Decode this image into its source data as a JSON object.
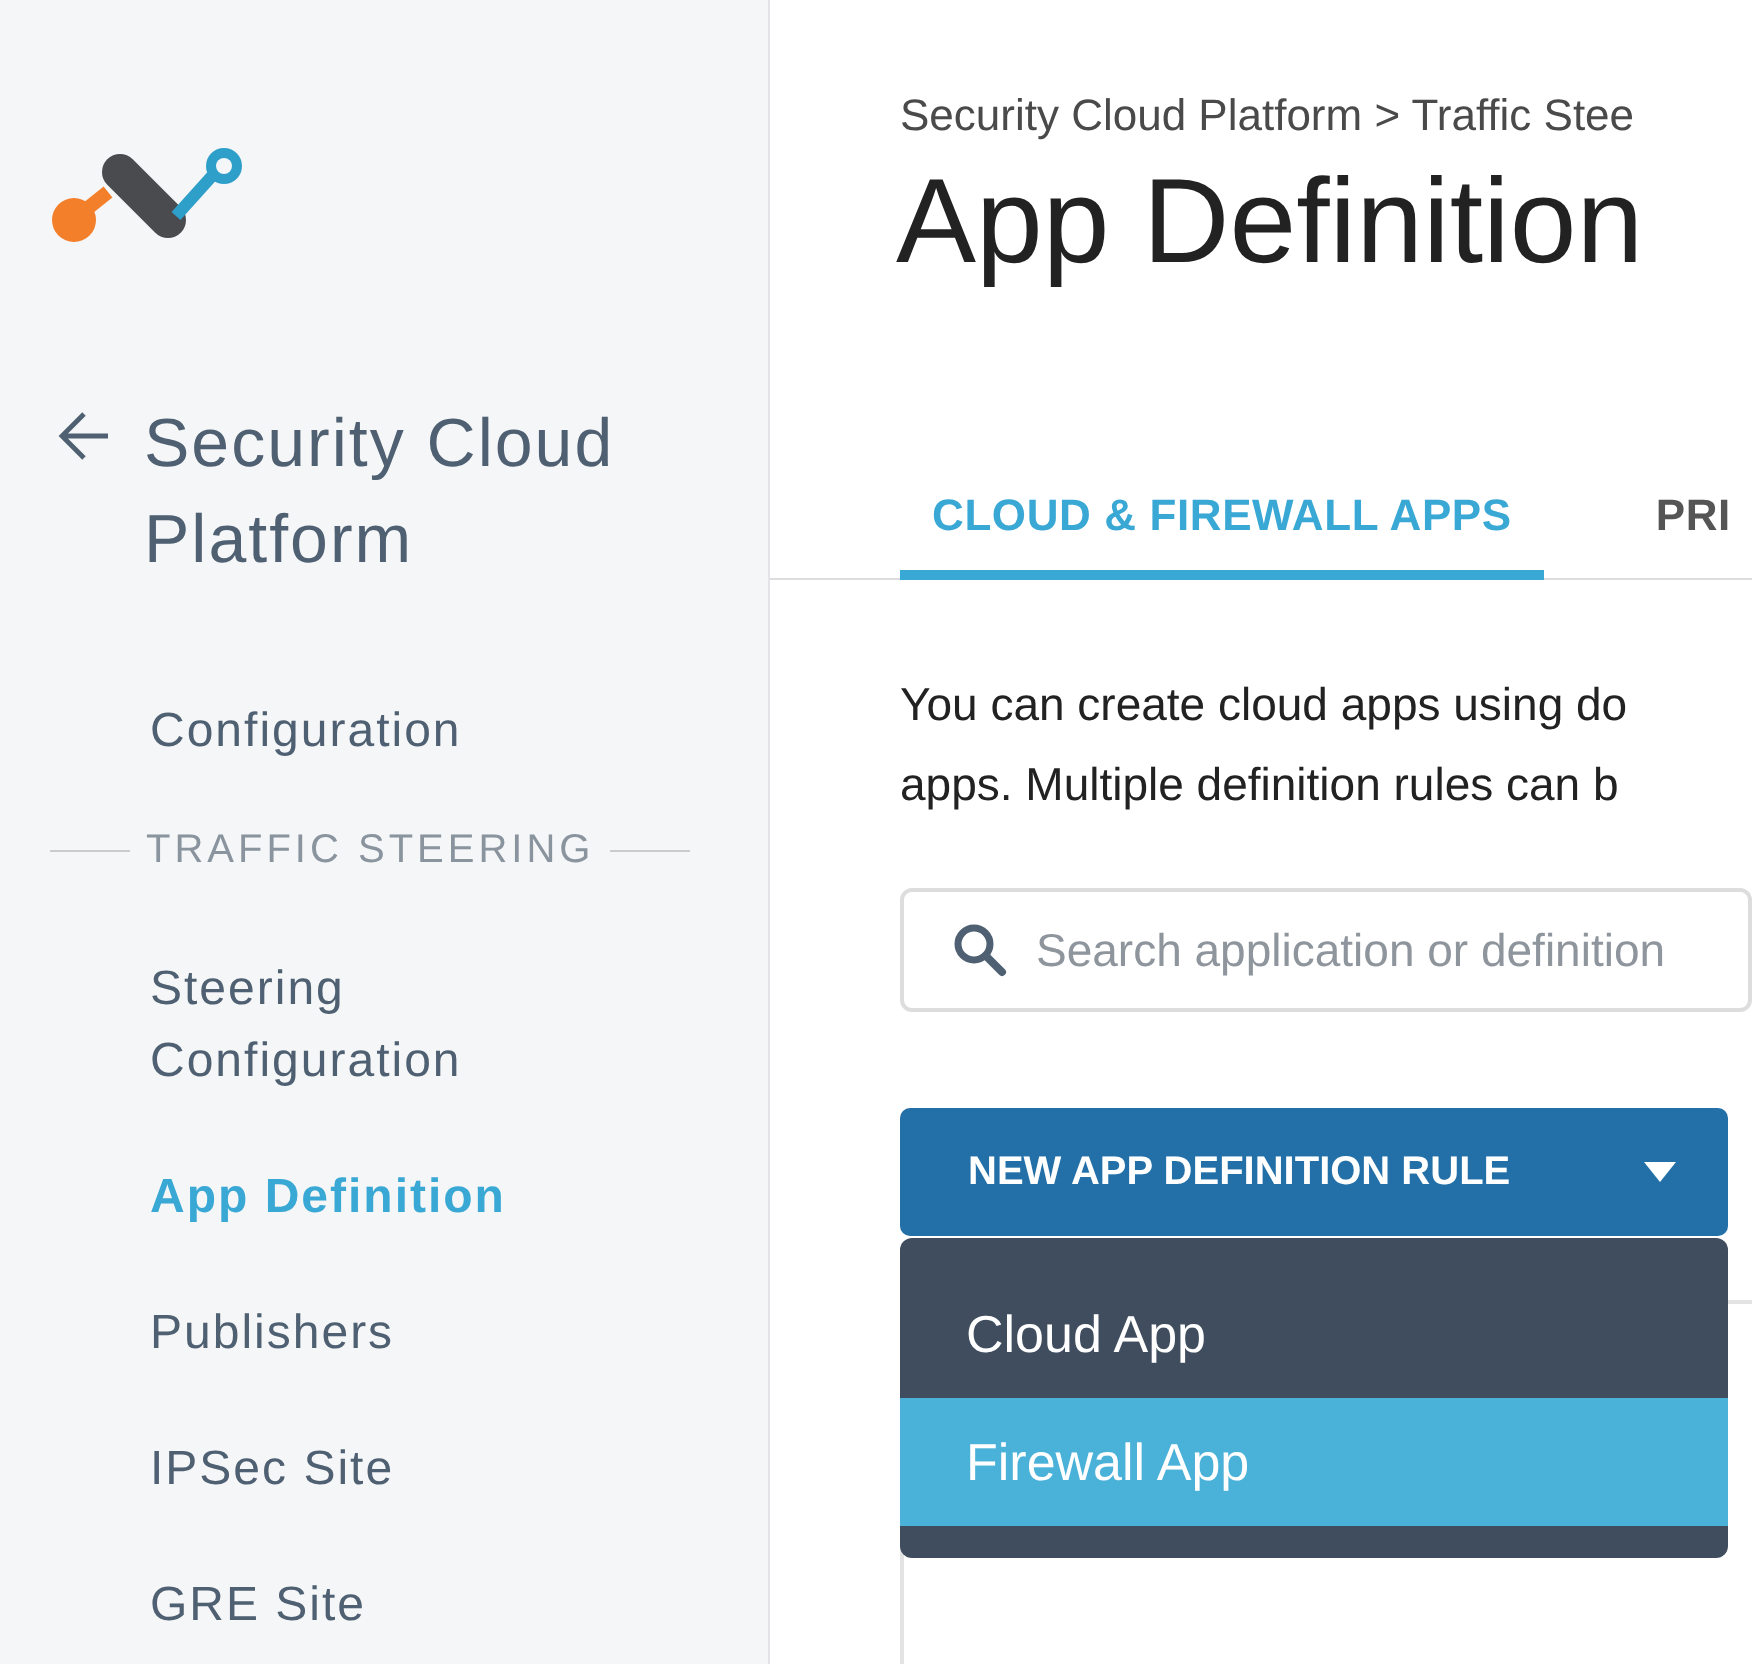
{
  "sidebar": {
    "back_title": "Security Cloud Platform",
    "items": [
      {
        "kind": "item",
        "label": "Configuration",
        "selected": false
      },
      {
        "kind": "section",
        "label": "TRAFFIC STEERING"
      },
      {
        "kind": "item",
        "label": "Steering Configuration",
        "selected": false
      },
      {
        "kind": "item",
        "label": "App Definition",
        "selected": true
      },
      {
        "kind": "item",
        "label": "Publishers",
        "selected": false
      },
      {
        "kind": "item",
        "label": "IPSec Site",
        "selected": false
      },
      {
        "kind": "item",
        "label": "GRE Site",
        "selected": false
      }
    ]
  },
  "breadcrumb": "Security Cloud Platform > Traffic Stee",
  "title": "App Definition",
  "tabs": [
    {
      "label": "CLOUD & FIREWALL APPS",
      "selected": true
    },
    {
      "label": "PRI",
      "selected": false
    }
  ],
  "description": [
    "You can create cloud apps using do",
    "apps. Multiple definition rules can b"
  ],
  "search": {
    "placeholder": "Search application or definition"
  },
  "new_rule_button": {
    "label": "NEW APP DEFINITION RULE",
    "expanded": true
  },
  "menu": [
    {
      "label": "Cloud App",
      "selected": false
    },
    {
      "label": "Firewall App",
      "selected": true
    }
  ]
}
